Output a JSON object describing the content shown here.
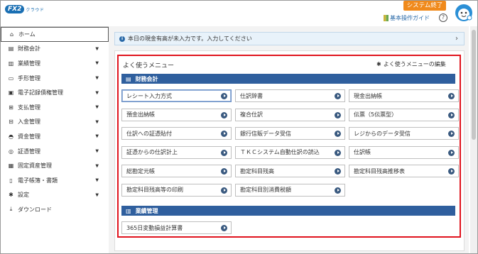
{
  "header": {
    "logo_mark": "FX2",
    "logo_text": "クラウド",
    "exit_label": "システム終了",
    "guide_label": "基本操作ガイド",
    "help_label": "?"
  },
  "sidebar": {
    "items": [
      {
        "label": "ホーム",
        "icon": "home-icon",
        "glyph": "⌂",
        "caret": ""
      },
      {
        "label": "財務会計",
        "icon": "ledger-icon",
        "glyph": "▤",
        "caret": "▼"
      },
      {
        "label": "業績管理",
        "icon": "bar-chart-icon",
        "glyph": "▥",
        "caret": "▼"
      },
      {
        "label": "手形管理",
        "icon": "bill-icon",
        "glyph": "▭",
        "caret": "▼"
      },
      {
        "label": "電子記録債権管理",
        "icon": "monitor-icon",
        "glyph": "▣",
        "caret": "▼"
      },
      {
        "label": "支払管理",
        "icon": "bank-icon",
        "glyph": "⊞",
        "caret": "▼"
      },
      {
        "label": "入金管理",
        "icon": "deposit-icon",
        "glyph": "⊟",
        "caret": "▼"
      },
      {
        "label": "資金管理",
        "icon": "money-bag-icon",
        "glyph": "◓",
        "caret": "▼"
      },
      {
        "label": "証憑管理",
        "icon": "voucher-icon",
        "glyph": "◎",
        "caret": "▼"
      },
      {
        "label": "固定資産管理",
        "icon": "building-icon",
        "glyph": "▦",
        "caret": "▼"
      },
      {
        "label": "電子帳簿・書類",
        "icon": "book-icon",
        "glyph": "▯",
        "caret": "▼"
      },
      {
        "label": "設定",
        "icon": "gear-icon",
        "glyph": "✱",
        "caret": "▼"
      },
      {
        "label": "ダウンロード",
        "icon": "download-icon",
        "glyph": "⤓",
        "caret": ""
      }
    ]
  },
  "notice": {
    "text": "本日の現金有高が未入力です。入力してください",
    "chevron": "›"
  },
  "favorites": {
    "title": "よく使うメニュー",
    "edit_label": "よく使うメニューの編集",
    "categories": [
      {
        "label": "財務会計",
        "buttons": [
          "レシート入力方式",
          "仕訳辞書",
          "現金出納帳",
          "預金出納帳",
          "複合仕訳",
          "伝票（5伝票型）",
          "仕訳への証憑貼付",
          "銀行信販データ受信",
          "レジからのデータ受信",
          "証憑からの仕訳計上",
          "ＴＫＣシステム自動仕訳の読込",
          "仕訳帳",
          "総勘定元帳",
          "勘定科目残高",
          "勘定科目残高推移表",
          "勘定科目残高等の印刷",
          "勘定科目別消費税額"
        ]
      },
      {
        "label": "業績管理",
        "buttons": [
          "365日変動損益計算書"
        ]
      }
    ]
  },
  "colors": {
    "accent": "#2f5f9e",
    "exit_button": "#f08a1c",
    "highlight_border": "#e0141e",
    "notice_bg": "#e8f2fa"
  }
}
